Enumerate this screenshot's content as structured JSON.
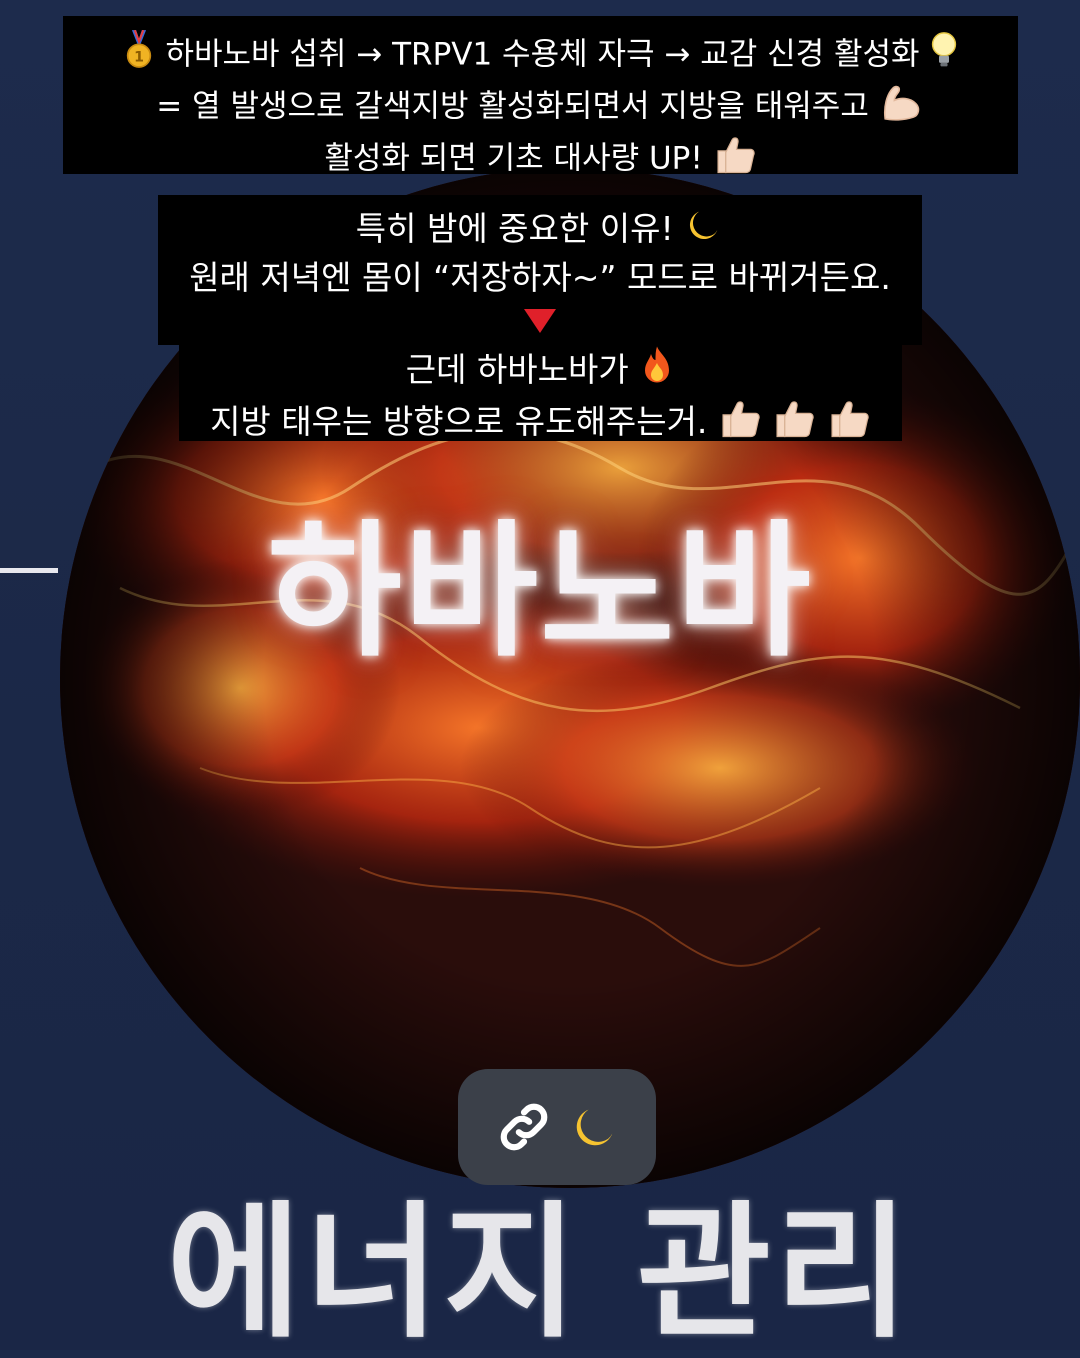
{
  "background_colors": {
    "page": "#1c2a4a",
    "caption_box": "#000000",
    "link_pill": "#3b4049",
    "fire": "#e2431a"
  },
  "overlay_captions": {
    "box1": {
      "line1_pre_emoji": "medal-icon",
      "line1_text": "하바노바 섭취 → TRPV1 수용체 자극 → 교감 신경 활성화",
      "line1_post_emoji": "lightbulb-icon",
      "line2_text": "= 열 발생으로 갈색지방 활성화되면서 지방을 태워주고",
      "line2_post_emoji": "flexed-arm-icon",
      "line3_text": "활성화 되면 기초 대사량 UP!",
      "line3_post_emoji": "thumbs-up-icon"
    },
    "box2": {
      "line1_text": "특히 밤에 중요한 이유!",
      "line1_post_emoji": "crescent-moon-icon",
      "line2_text": "원래 저녁엔 몸이 “저장하자~” 모드로 바뀌거든요.",
      "line3_emoji": "red-down-triangle-icon"
    },
    "box3": {
      "line1_text": "근데 하바노바가",
      "line1_post_emoji": "fire-icon",
      "line2_text": "지방 태우는 방향으로 유도해주는거.",
      "line2_post_emoji": "three-thumbs-up-icons"
    }
  },
  "graphic": {
    "glow_title": "하바노바",
    "bottom_title": "에너지 관리"
  },
  "link_sticker": {
    "icon": "link-icon",
    "emoji": "crescent-moon-icon"
  }
}
